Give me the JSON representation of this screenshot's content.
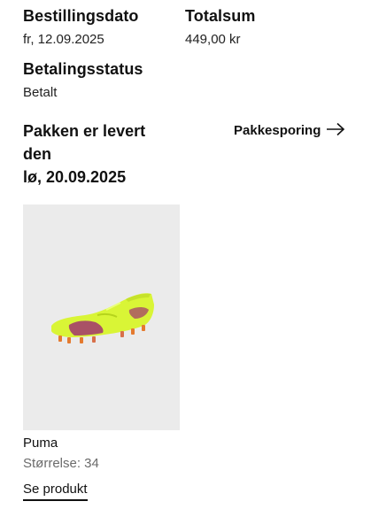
{
  "order": {
    "order_date_label": "Bestillingsdato",
    "order_date_value": "fr, 12.09.2025",
    "total_label": "Totalsum",
    "total_value": "449,00 kr",
    "payment_status_label": "Betalingsstatus",
    "payment_status_value": "Betalt"
  },
  "delivery": {
    "status_line1": "Pakken er levert",
    "status_line2": "den",
    "status_line3": "lø, 20.09.2025",
    "tracking_label": "Pakkesporing",
    "tracking_icon": "arrow-right-icon"
  },
  "product": {
    "image_icon": "football-boot-image",
    "image_colors": {
      "boot": "#d8f536",
      "accent": "#a0346e",
      "background": "#ebebeb"
    },
    "brand": "Puma",
    "size_text": "Størrelse: 34",
    "see_product_label": "Se produkt"
  }
}
